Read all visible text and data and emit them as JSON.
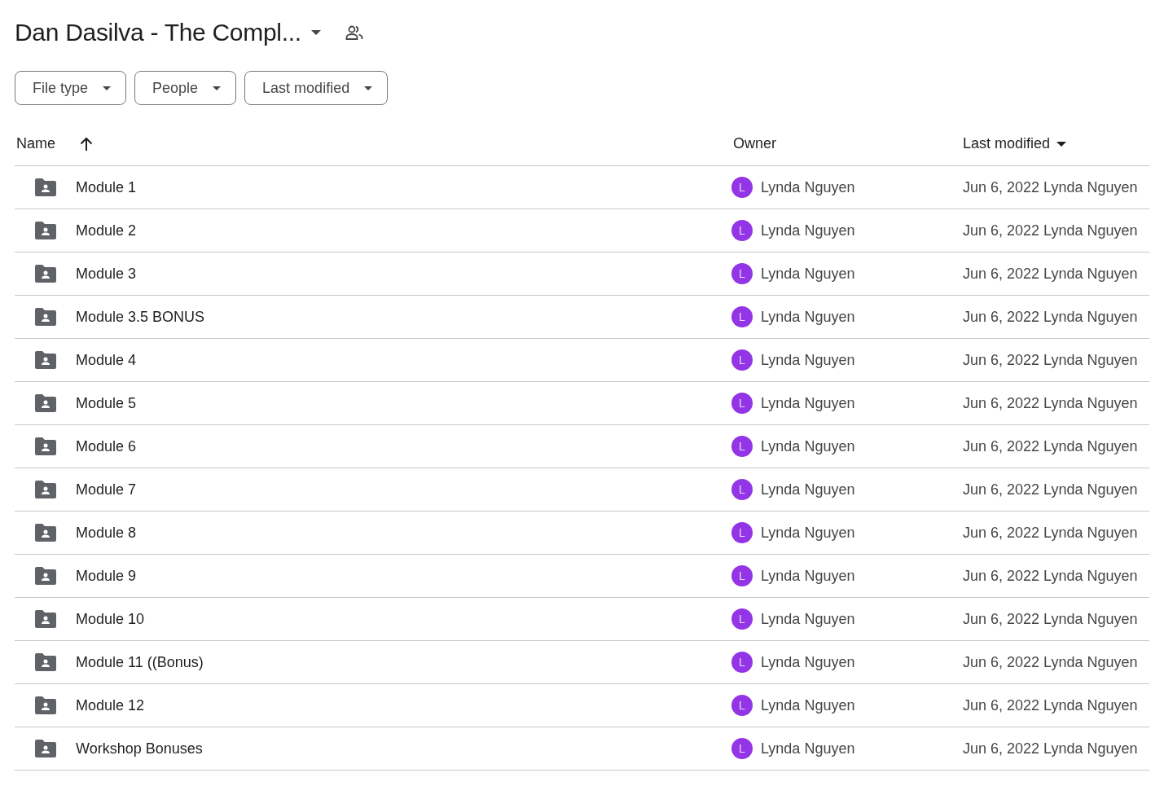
{
  "folder": {
    "title": "Dan Dasilva - The Compl..."
  },
  "filters": [
    "File type",
    "People",
    "Last modified"
  ],
  "table": {
    "columns": [
      "Name",
      "Owner",
      "Last modified"
    ],
    "rows": [
      {
        "name": "Module 1",
        "owner_initial": "L",
        "owner": "Lynda Nguyen",
        "modified": "Jun 6, 2022",
        "modified_by": "Lynda Nguyen"
      },
      {
        "name": "Module 2",
        "owner_initial": "L",
        "owner": "Lynda Nguyen",
        "modified": "Jun 6, 2022",
        "modified_by": "Lynda Nguyen"
      },
      {
        "name": "Module 3",
        "owner_initial": "L",
        "owner": "Lynda Nguyen",
        "modified": "Jun 6, 2022",
        "modified_by": "Lynda Nguyen"
      },
      {
        "name": "Module 3.5 BONUS",
        "owner_initial": "L",
        "owner": "Lynda Nguyen",
        "modified": "Jun 6, 2022",
        "modified_by": "Lynda Nguyen"
      },
      {
        "name": "Module 4",
        "owner_initial": "L",
        "owner": "Lynda Nguyen",
        "modified": "Jun 6, 2022",
        "modified_by": "Lynda Nguyen"
      },
      {
        "name": "Module 5",
        "owner_initial": "L",
        "owner": "Lynda Nguyen",
        "modified": "Jun 6, 2022",
        "modified_by": "Lynda Nguyen"
      },
      {
        "name": "Module 6",
        "owner_initial": "L",
        "owner": "Lynda Nguyen",
        "modified": "Jun 6, 2022",
        "modified_by": "Lynda Nguyen"
      },
      {
        "name": "Module 7",
        "owner_initial": "L",
        "owner": "Lynda Nguyen",
        "modified": "Jun 6, 2022",
        "modified_by": "Lynda Nguyen"
      },
      {
        "name": "Module 8",
        "owner_initial": "L",
        "owner": "Lynda Nguyen",
        "modified": "Jun 6, 2022",
        "modified_by": "Lynda Nguyen"
      },
      {
        "name": "Module 9",
        "owner_initial": "L",
        "owner": "Lynda Nguyen",
        "modified": "Jun 6, 2022",
        "modified_by": "Lynda Nguyen"
      },
      {
        "name": "Module 10",
        "owner_initial": "L",
        "owner": "Lynda Nguyen",
        "modified": "Jun 6, 2022",
        "modified_by": "Lynda Nguyen"
      },
      {
        "name": "Module 11 ((Bonus)",
        "owner_initial": "L",
        "owner": "Lynda Nguyen",
        "modified": "Jun 6, 2022",
        "modified_by": "Lynda Nguyen"
      },
      {
        "name": "Module 12",
        "owner_initial": "L",
        "owner": "Lynda Nguyen",
        "modified": "Jun 6, 2022",
        "modified_by": "Lynda Nguyen"
      },
      {
        "name": "Workshop Bonuses",
        "owner_initial": "L",
        "owner": "Lynda Nguyen",
        "modified": "Jun 6, 2022",
        "modified_by": "Lynda Nguyen"
      }
    ]
  }
}
